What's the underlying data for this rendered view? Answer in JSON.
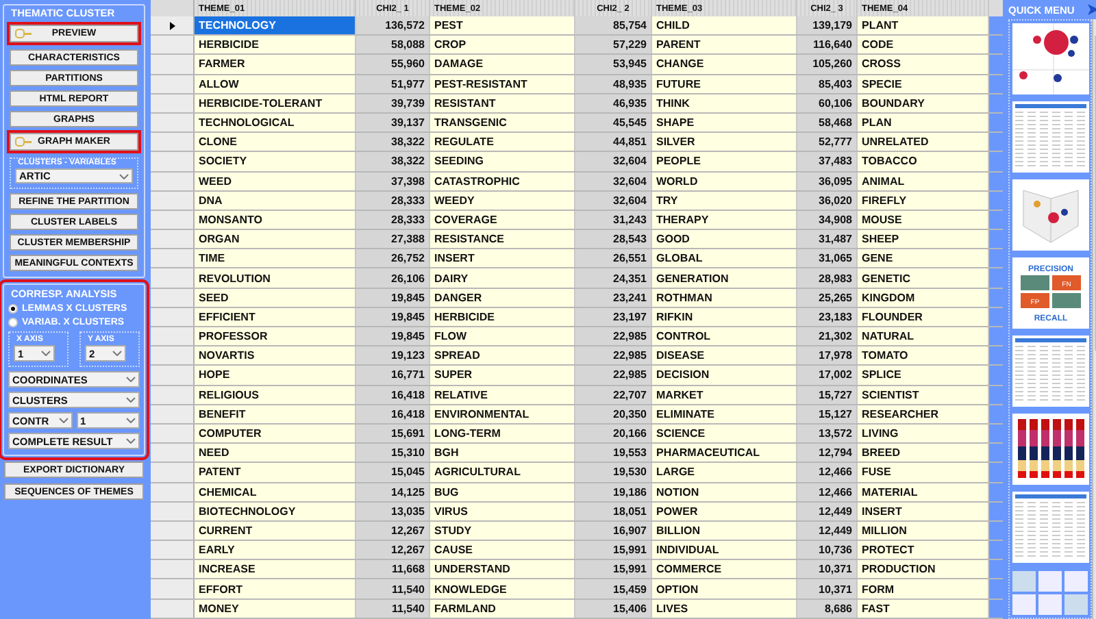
{
  "sidebar": {
    "sections": [
      {
        "title": "THEMATIC CLUSTER",
        "highlighted": false,
        "items": [
          {
            "kind": "button",
            "label": "PREVIEW",
            "highlighted": true
          },
          {
            "kind": "button",
            "label": "CHARACTERISTICS",
            "highlighted": false
          },
          {
            "kind": "button",
            "label": "PARTITIONS",
            "highlighted": false
          },
          {
            "kind": "button",
            "label": "HTML REPORT",
            "highlighted": false
          },
          {
            "kind": "button",
            "label": "GRAPHS",
            "highlighted": false
          },
          {
            "kind": "button",
            "label": "GRAPH MAKER",
            "highlighted": true
          },
          {
            "kind": "select_group",
            "title": "CLUSTERS - VARIABLES",
            "value": "ARTIC"
          },
          {
            "kind": "button",
            "label": "REFINE THE PARTITION",
            "highlighted": false
          },
          {
            "kind": "button",
            "label": "CLUSTER LABELS",
            "highlighted": false
          },
          {
            "kind": "button",
            "label": "CLUSTER MEMBERSHIP",
            "highlighted": false
          },
          {
            "kind": "button",
            "label": "MEANINGFUL CONTEXTS",
            "highlighted": false
          }
        ]
      },
      {
        "title": "CORRESP. ANALYSIS",
        "highlighted": true,
        "items": [
          {
            "kind": "radio",
            "label": "LEMMAS X CLUSTERS",
            "selected": true
          },
          {
            "kind": "radio",
            "label": "VARIAB. X CLUSTERS",
            "selected": false
          },
          {
            "kind": "axes",
            "axes": [
              {
                "title": "X AXIS",
                "value": "1"
              },
              {
                "title": "Y AXIS",
                "value": "2"
              }
            ]
          },
          {
            "kind": "select",
            "values": [
              "COORDINATES"
            ]
          },
          {
            "kind": "select",
            "values": [
              "CLUSTERS"
            ]
          },
          {
            "kind": "select",
            "values": [
              "CONTR",
              "1"
            ]
          },
          {
            "kind": "select",
            "values": [
              "COMPLETE RESULT"
            ]
          }
        ]
      }
    ],
    "buttons": [
      "EXPORT DICTIONARY",
      "SEQUENCES OF THEMES"
    ]
  },
  "table": {
    "columns": [
      "THEME_01",
      "CHI2_ 1",
      "THEME_02",
      "CHI2_ 2",
      "THEME_03",
      "CHI2_ 3",
      "THEME_04"
    ],
    "rows": [
      {
        "selected": true,
        "cells": [
          "TECHNOLOGY",
          "136,572",
          "PEST",
          "85,754",
          "CHILD",
          "139,179",
          "PLANT"
        ]
      },
      {
        "selected": false,
        "cells": [
          "HERBICIDE",
          "58,088",
          "CROP",
          "57,229",
          "PARENT",
          "116,640",
          "CODE"
        ]
      },
      {
        "selected": false,
        "cells": [
          "FARMER",
          "55,960",
          "DAMAGE",
          "53,945",
          "CHANGE",
          "105,260",
          "CROSS"
        ]
      },
      {
        "selected": false,
        "cells": [
          "ALLOW",
          "51,977",
          "PEST-RESISTANT",
          "48,935",
          "FUTURE",
          "85,403",
          "SPECIE"
        ]
      },
      {
        "selected": false,
        "cells": [
          "HERBICIDE-TOLERANT",
          "39,739",
          "RESISTANT",
          "46,935",
          "THINK",
          "60,106",
          "BOUNDARY"
        ]
      },
      {
        "selected": false,
        "cells": [
          "TECHNOLOGICAL",
          "39,137",
          "TRANSGENIC",
          "45,545",
          "SHAPE",
          "58,468",
          "PLAN"
        ]
      },
      {
        "selected": false,
        "cells": [
          "CLONE",
          "38,322",
          "REGULATE",
          "44,851",
          "SILVER",
          "52,777",
          "UNRELATED"
        ]
      },
      {
        "selected": false,
        "cells": [
          "SOCIETY",
          "38,322",
          "SEEDING",
          "32,604",
          "PEOPLE",
          "37,483",
          "TOBACCO"
        ]
      },
      {
        "selected": false,
        "cells": [
          "WEED",
          "37,398",
          "CATASTROPHIC",
          "32,604",
          "WORLD",
          "36,095",
          "ANIMAL"
        ]
      },
      {
        "selected": false,
        "cells": [
          "DNA",
          "28,333",
          "WEEDY",
          "32,604",
          "TRY",
          "36,020",
          "FIREFLY"
        ]
      },
      {
        "selected": false,
        "cells": [
          "MONSANTO",
          "28,333",
          "COVERAGE",
          "31,243",
          "THERAPY",
          "34,908",
          "MOUSE"
        ]
      },
      {
        "selected": false,
        "cells": [
          "ORGAN",
          "27,388",
          "RESISTANCE",
          "28,543",
          "GOOD",
          "31,487",
          "SHEEP"
        ]
      },
      {
        "selected": false,
        "cells": [
          "TIME",
          "26,752",
          "INSERT",
          "26,551",
          "GLOBAL",
          "31,065",
          "GENE"
        ]
      },
      {
        "selected": false,
        "cells": [
          "REVOLUTION",
          "26,106",
          "DAIRY",
          "24,351",
          "GENERATION",
          "28,983",
          "GENETIC"
        ]
      },
      {
        "selected": false,
        "cells": [
          "SEED",
          "19,845",
          "DANGER",
          "23,241",
          "ROTHMAN",
          "25,265",
          "KINGDOM"
        ]
      },
      {
        "selected": false,
        "cells": [
          "EFFICIENT",
          "19,845",
          "HERBICIDE",
          "23,197",
          "RIFKIN",
          "23,183",
          "FLOUNDER"
        ]
      },
      {
        "selected": false,
        "cells": [
          "PROFESSOR",
          "19,845",
          "FLOW",
          "22,985",
          "CONTROL",
          "21,302",
          "NATURAL"
        ]
      },
      {
        "selected": false,
        "cells": [
          "NOVARTIS",
          "19,123",
          "SPREAD",
          "22,985",
          "DISEASE",
          "17,978",
          "TOMATO"
        ]
      },
      {
        "selected": false,
        "cells": [
          "HOPE",
          "16,771",
          "SUPER",
          "22,985",
          "DECISION",
          "17,002",
          "SPLICE"
        ]
      },
      {
        "selected": false,
        "cells": [
          "RELIGIOUS",
          "16,418",
          "RELATIVE",
          "22,707",
          "MARKET",
          "15,727",
          "SCIENTIST"
        ]
      },
      {
        "selected": false,
        "cells": [
          "BENEFIT",
          "16,418",
          "ENVIRONMENTAL",
          "20,350",
          "ELIMINATE",
          "15,127",
          "RESEARCHER"
        ]
      },
      {
        "selected": false,
        "cells": [
          "COMPUTER",
          "15,691",
          "LONG-TERM",
          "20,166",
          "SCIENCE",
          "13,572",
          "LIVING"
        ]
      },
      {
        "selected": false,
        "cells": [
          "NEED",
          "15,310",
          "BGH",
          "19,553",
          "PHARMACEUTICAL",
          "12,794",
          "BREED"
        ]
      },
      {
        "selected": false,
        "cells": [
          "PATENT",
          "15,045",
          "AGRICULTURAL",
          "19,530",
          "LARGE",
          "12,466",
          "FUSE"
        ]
      },
      {
        "selected": false,
        "cells": [
          "CHEMICAL",
          "14,125",
          "BUG",
          "19,186",
          "NOTION",
          "12,466",
          "MATERIAL"
        ]
      },
      {
        "selected": false,
        "cells": [
          "BIOTECHNOLOGY",
          "13,035",
          "VIRUS",
          "18,051",
          "POWER",
          "12,449",
          "INSERT"
        ]
      },
      {
        "selected": false,
        "cells": [
          "CURRENT",
          "12,267",
          "STUDY",
          "16,907",
          "BILLION",
          "12,449",
          "MILLION"
        ]
      },
      {
        "selected": false,
        "cells": [
          "EARLY",
          "12,267",
          "CAUSE",
          "15,991",
          "INDIVIDUAL",
          "10,736",
          "PROTECT"
        ]
      },
      {
        "selected": false,
        "cells": [
          "INCREASE",
          "11,668",
          "UNDERSTAND",
          "15,991",
          "COMMERCE",
          "10,371",
          "PRODUCTION"
        ]
      },
      {
        "selected": false,
        "cells": [
          "EFFORT",
          "11,540",
          "KNOWLEDGE",
          "15,459",
          "OPTION",
          "10,371",
          "FORM"
        ]
      },
      {
        "selected": false,
        "cells": [
          "MONEY",
          "11,540",
          "FARMLAND",
          "15,406",
          "LIVES",
          "8,686",
          "FAST"
        ]
      }
    ]
  },
  "quick_menu": {
    "title": "QUICK MENU",
    "thumbnails": [
      {
        "kind": "bubbles"
      },
      {
        "kind": "table"
      },
      {
        "kind": "scatter3d"
      },
      {
        "kind": "matrix",
        "texts": [
          "PRECISION",
          "FN",
          "FP",
          "RECALL"
        ]
      },
      {
        "kind": "table"
      },
      {
        "kind": "stacked"
      },
      {
        "kind": "table"
      },
      {
        "kind": "mosaic"
      }
    ]
  }
}
